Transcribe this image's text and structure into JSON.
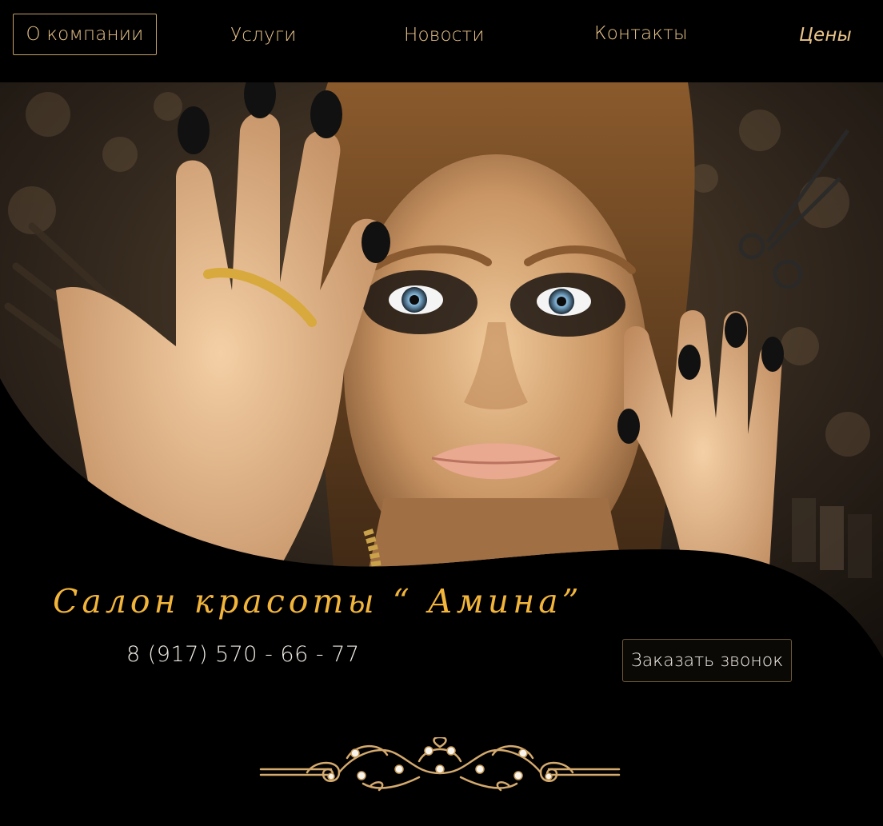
{
  "nav": {
    "items": [
      {
        "label": "О компании",
        "active": true
      },
      {
        "label": "Услуги",
        "active": false
      },
      {
        "label": "Новости",
        "active": false
      },
      {
        "label": "Контакты",
        "active": false
      },
      {
        "label": "Цены",
        "active": false
      }
    ]
  },
  "hero": {
    "image_icon": "woman-portrait-image",
    "title": "Салон красоты “ Амина”",
    "phone": "8 (917) 570 - 66 - 77",
    "call_button": "Заказать звонок"
  },
  "colors": {
    "accent": "#e9c489",
    "title_gold": "#f2b53a",
    "background": "#000000",
    "button_border": "#6d5a3a"
  },
  "decor": {
    "ornament_icon": "gold-ornament-divider"
  }
}
